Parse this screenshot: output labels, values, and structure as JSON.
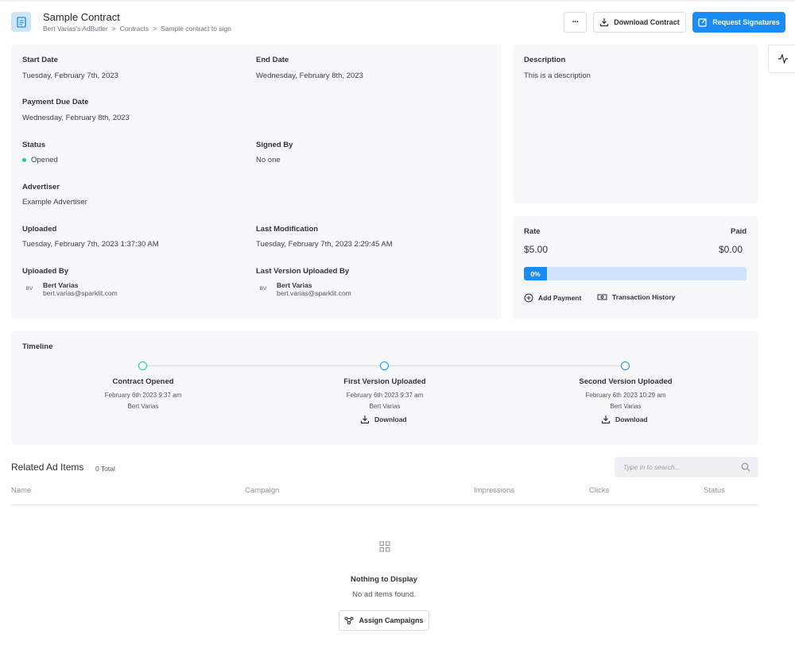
{
  "header": {
    "title": "Sample Contract",
    "breadcrumbs": [
      "Bert Varias's AdButler",
      ">",
      "Contracts",
      ">",
      "Sample contract to sign"
    ],
    "more_label": "···",
    "download_label": "Download Contract",
    "request_label": "Request Signatures"
  },
  "details": {
    "start_date": {
      "label": "Start Date",
      "value": "Tuesday, February 7th, 2023"
    },
    "end_date": {
      "label": "End Date",
      "value": "Wednesday, February 8th, 2023"
    },
    "payment_due": {
      "label": "Payment Due Date",
      "value": "Wednesday, February 8th, 2023"
    },
    "status": {
      "label": "Status",
      "value": "Opened"
    },
    "signed_by": {
      "label": "Signed By",
      "value": "No one"
    },
    "advertiser": {
      "label": "Advertiser",
      "value": "Example Advertiser"
    },
    "uploaded": {
      "label": "Uploaded",
      "value": "Tuesday, February 7th, 2023 1:37:30 AM"
    },
    "last_modification": {
      "label": "Last Modification",
      "value": "Tuesday, February 7th, 2023 2:29:45 AM"
    },
    "uploaded_by": {
      "label": "Uploaded By",
      "initials": "BV",
      "name": "Bert Varias",
      "email": "bert.varias@sparklit.com"
    },
    "last_version_by": {
      "label": "Last Version Uploaded By",
      "initials": "BV",
      "name": "Bert Varias",
      "email": "bert.varias@sparklit.com"
    }
  },
  "description": {
    "label": "Description",
    "value": "This is a description"
  },
  "rate": {
    "rate_label": "Rate",
    "rate_value": "$5.00",
    "paid_label": "Paid",
    "paid_value": "$0.00",
    "progress_percent": 0,
    "progress_label": "0%",
    "add_payment": "Add Payment",
    "transaction_history": "Transaction History"
  },
  "timeline": {
    "label": "Timeline",
    "events": [
      {
        "title": "Contract Opened",
        "date": "February 6th 2023 9:37 am",
        "user": "Bert Varias",
        "download": null,
        "color": "#34c38f"
      },
      {
        "title": "First Version Uploaded",
        "date": "February 6th 2023 9:37 am",
        "user": "Bert Varias",
        "download": "Download",
        "color": "#1a8cf6"
      },
      {
        "title": "Second Version Uploaded",
        "date": "February 6th 2023 10:29 am",
        "user": "Bert Varias",
        "download": "Download",
        "color": "#1a8cf6"
      }
    ]
  },
  "related": {
    "title": "Related Ad Items",
    "total": "0 Total",
    "search_placeholder": "Type in to search...",
    "columns": [
      "Name",
      "Campaign",
      "Impressions",
      "Clicks",
      "Status"
    ],
    "empty_title": "Nothing to Display",
    "empty_sub": "No ad items found.",
    "assign_label": "Assign Campaigns"
  },
  "colors": {
    "accent": "#1a8cf6",
    "accent_light": "#cfe3fb",
    "status_green": "#34c38f"
  }
}
